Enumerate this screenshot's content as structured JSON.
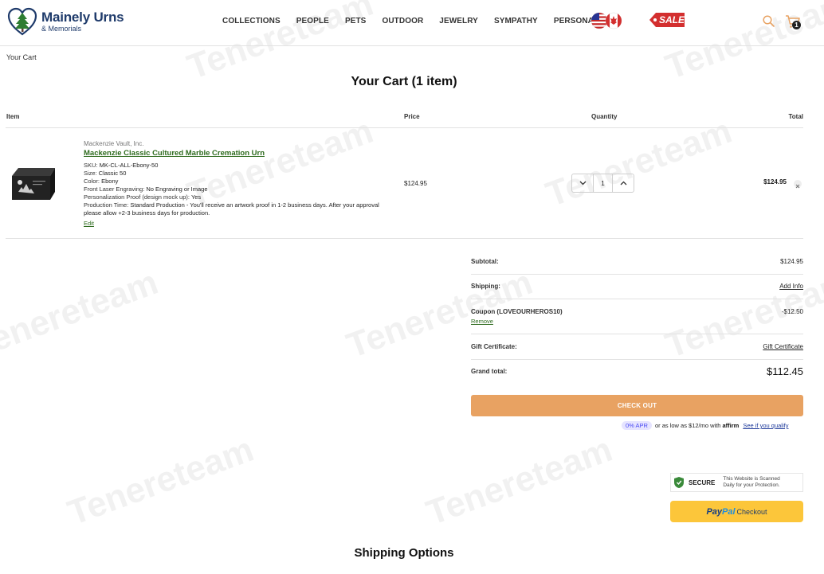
{
  "header": {
    "logo_name": "Mainely Urns",
    "logo_sub": "& Memorials",
    "nav": [
      "COLLECTIONS",
      "PEOPLE",
      "PETS",
      "OUTDOOR",
      "JEWELRY",
      "SYMPATHY",
      "PERSONALIZE"
    ],
    "sale_label": "SALE",
    "cart_count": "1"
  },
  "breadcrumb": "Your Cart",
  "page_title": "Your Cart (1 item)",
  "table_headers": {
    "item": "Item",
    "price": "Price",
    "quantity": "Quantity",
    "total": "Total"
  },
  "cart_item": {
    "brand": "Mackenzie Vault, Inc.",
    "title": "Mackenzie Classic Cultured Marble Cremation Urn",
    "details": [
      {
        "label": "SKU:",
        "value": "MK-CL-ALL-Ebony-50"
      },
      {
        "label": "Size:",
        "value": "Classic 50"
      },
      {
        "label": "Color:",
        "value": "Ebony"
      },
      {
        "label": "Front Laser Engraving:",
        "value": "No Engraving or Image"
      },
      {
        "label": "Personalization Proof (design mock up):",
        "value": "Yes"
      },
      {
        "label": "Production Time:",
        "value": "Standard Production - You'll receive an artwork proof in 1-2 business days. After your approval please allow +2-3 business days for production."
      }
    ],
    "edit_label": "Edit",
    "price": "$124.95",
    "quantity": "1",
    "total": "$124.95"
  },
  "totals": {
    "subtotal_label": "Subtotal:",
    "subtotal_value": "$124.95",
    "shipping_label": "Shipping:",
    "shipping_value": "Add Info",
    "coupon_label": "Coupon (LOVEOURHEROS10)",
    "coupon_value": "-$12.50",
    "coupon_remove": "Remove",
    "gift_label": "Gift Certificate:",
    "gift_value": "Gift Certificate",
    "grand_label": "Grand total:",
    "grand_value": "$112.45"
  },
  "checkout_label": "CHECK OUT",
  "affirm": {
    "apr": "0% APR",
    "text": "or as low as $12/mo with",
    "logo": "affirm",
    "link": "See if you qualify"
  },
  "trust": {
    "name_top": "SECURE",
    "text_line1": "This Website is Scanned",
    "text_line2": "Daily for your Protection."
  },
  "paypal": {
    "logo_a": "Pay",
    "logo_b": "Pal",
    "text": "Checkout"
  },
  "shipping_title": "Shipping Options",
  "colors": {
    "brand_navy": "#1f3b6b",
    "link_green": "#2e6b1e",
    "checkout_orange": "#e8a262",
    "paypal_yellow": "#fcc63a"
  }
}
